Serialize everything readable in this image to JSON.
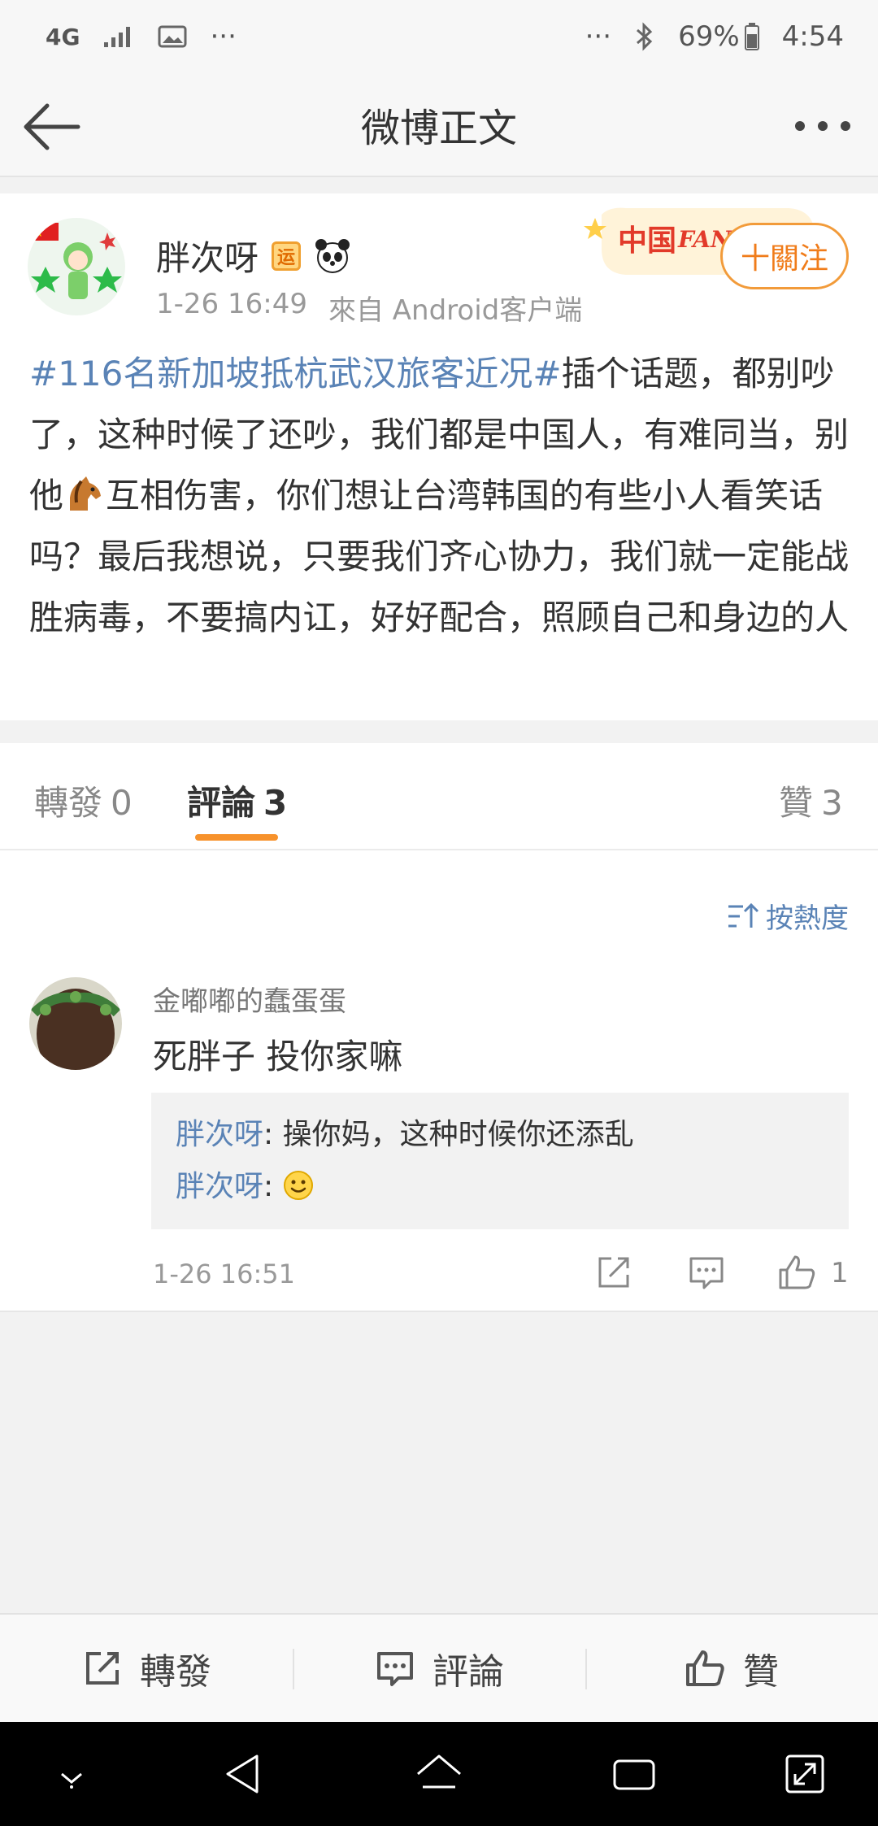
{
  "status_bar": {
    "network": "4G",
    "battery": "69%",
    "time": "4:54"
  },
  "nav": {
    "title": "微博正文"
  },
  "post": {
    "author": "胖次呀",
    "badge": "运",
    "time": "1-26 16:49",
    "source": "來自 Android客户端",
    "follow_label": "十關注",
    "topic": "#116名新加坡抵杭武汉旅客近况#",
    "text_part1": "插个话题，都别吵了，这种时候了还吵，我们都是中国人，有难同当，别他",
    "text_part2": "互相伤害，你们想让台湾韩国的有些小人看笑话吗？最后我想说，只要我们齐心协力，我们就一定能战胜病毒，不要搞内讧，好好配合，照顾自己和身边的人"
  },
  "tabs": {
    "repost_label": "轉發",
    "repost_count": "0",
    "comment_label": "評論",
    "comment_count": "3",
    "like_label": "贊",
    "like_count": "3"
  },
  "comments": {
    "sort_label": "按熱度",
    "items": [
      {
        "user": "金嘟嘟的蠢蛋蛋",
        "text": "死胖子 投你家嘛",
        "replies": [
          {
            "name": "胖次呀",
            "sep": ":",
            "text": " 操你妈，这种时候你还添乱"
          },
          {
            "name": "胖次呀",
            "sep": ":",
            "text": " "
          }
        ],
        "time": "1-26 16:51",
        "likes": "1"
      }
    ]
  },
  "bottom_bar": {
    "repost": "轉發",
    "comment": "評論",
    "like": "贊"
  },
  "colors": {
    "link": "#5a83b6",
    "accent": "#f7922b"
  },
  "icons": [
    "back-arrow-icon",
    "more-icon",
    "share-icon",
    "comment-icon",
    "like-icon"
  ]
}
